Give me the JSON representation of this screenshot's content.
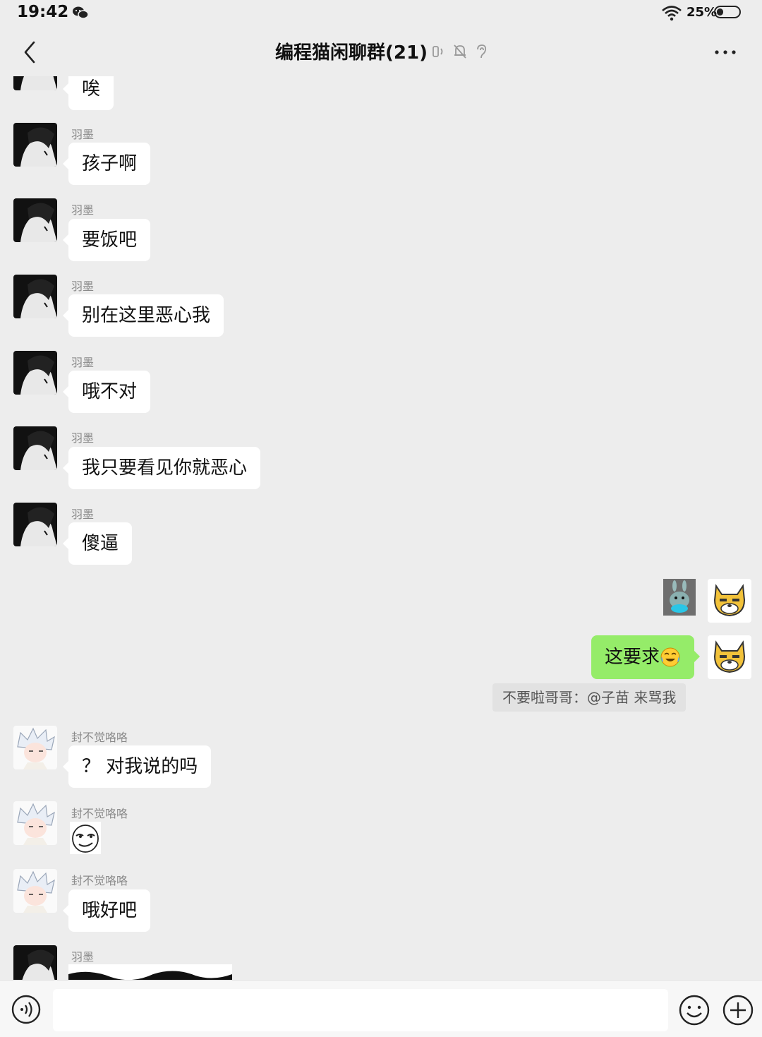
{
  "status_bar": {
    "time": "19:42",
    "battery_percent": "25%",
    "icons": [
      "wechat-icon",
      "wifi-icon",
      "battery-icon"
    ]
  },
  "header": {
    "title": "编程猫闲聊群(21)",
    "icons": [
      "back-icon",
      "earpiece-icon",
      "mute-bell-icon",
      "hearing-icon",
      "more-icon"
    ]
  },
  "messages": [
    {
      "sender": "",
      "text": "唉"
    },
    {
      "sender": "羽墨",
      "text": "孩子啊"
    },
    {
      "sender": "羽墨",
      "text": "要饭吧"
    },
    {
      "sender": "羽墨",
      "text": "别在这里恶心我"
    },
    {
      "sender": "羽墨",
      "text": "哦不对"
    },
    {
      "sender": "羽墨",
      "text": "我只要看见你就恶心"
    },
    {
      "sender": "羽墨",
      "text": "傻逼"
    },
    {
      "sender": "self",
      "type": "sticker",
      "sticker": "bunny-sticker"
    },
    {
      "sender": "self",
      "text": "这要求",
      "emoji": "crying-laughing-emoji",
      "quote": "不要啦哥哥：@子苗 来骂我"
    },
    {
      "sender": "封不觉咯咯",
      "text": "？ 对我说的吗"
    },
    {
      "sender": "封不觉咯咯",
      "type": "sticker",
      "sticker": "smirk-face-sticker"
    },
    {
      "sender": "封不觉咯咯",
      "text": "哦好吧"
    },
    {
      "sender": "羽墨",
      "type": "image",
      "image": "scribble-image"
    }
  ],
  "input_bar": {
    "placeholder": "",
    "icons": [
      "voice-icon",
      "emoji-icon",
      "plus-icon"
    ]
  },
  "colors": {
    "background": "#ededed",
    "bubble_incoming": "#ffffff",
    "bubble_outgoing": "#95ec69",
    "sender_name": "#8a8a8a",
    "quote_bg": "#e2e2e2"
  }
}
